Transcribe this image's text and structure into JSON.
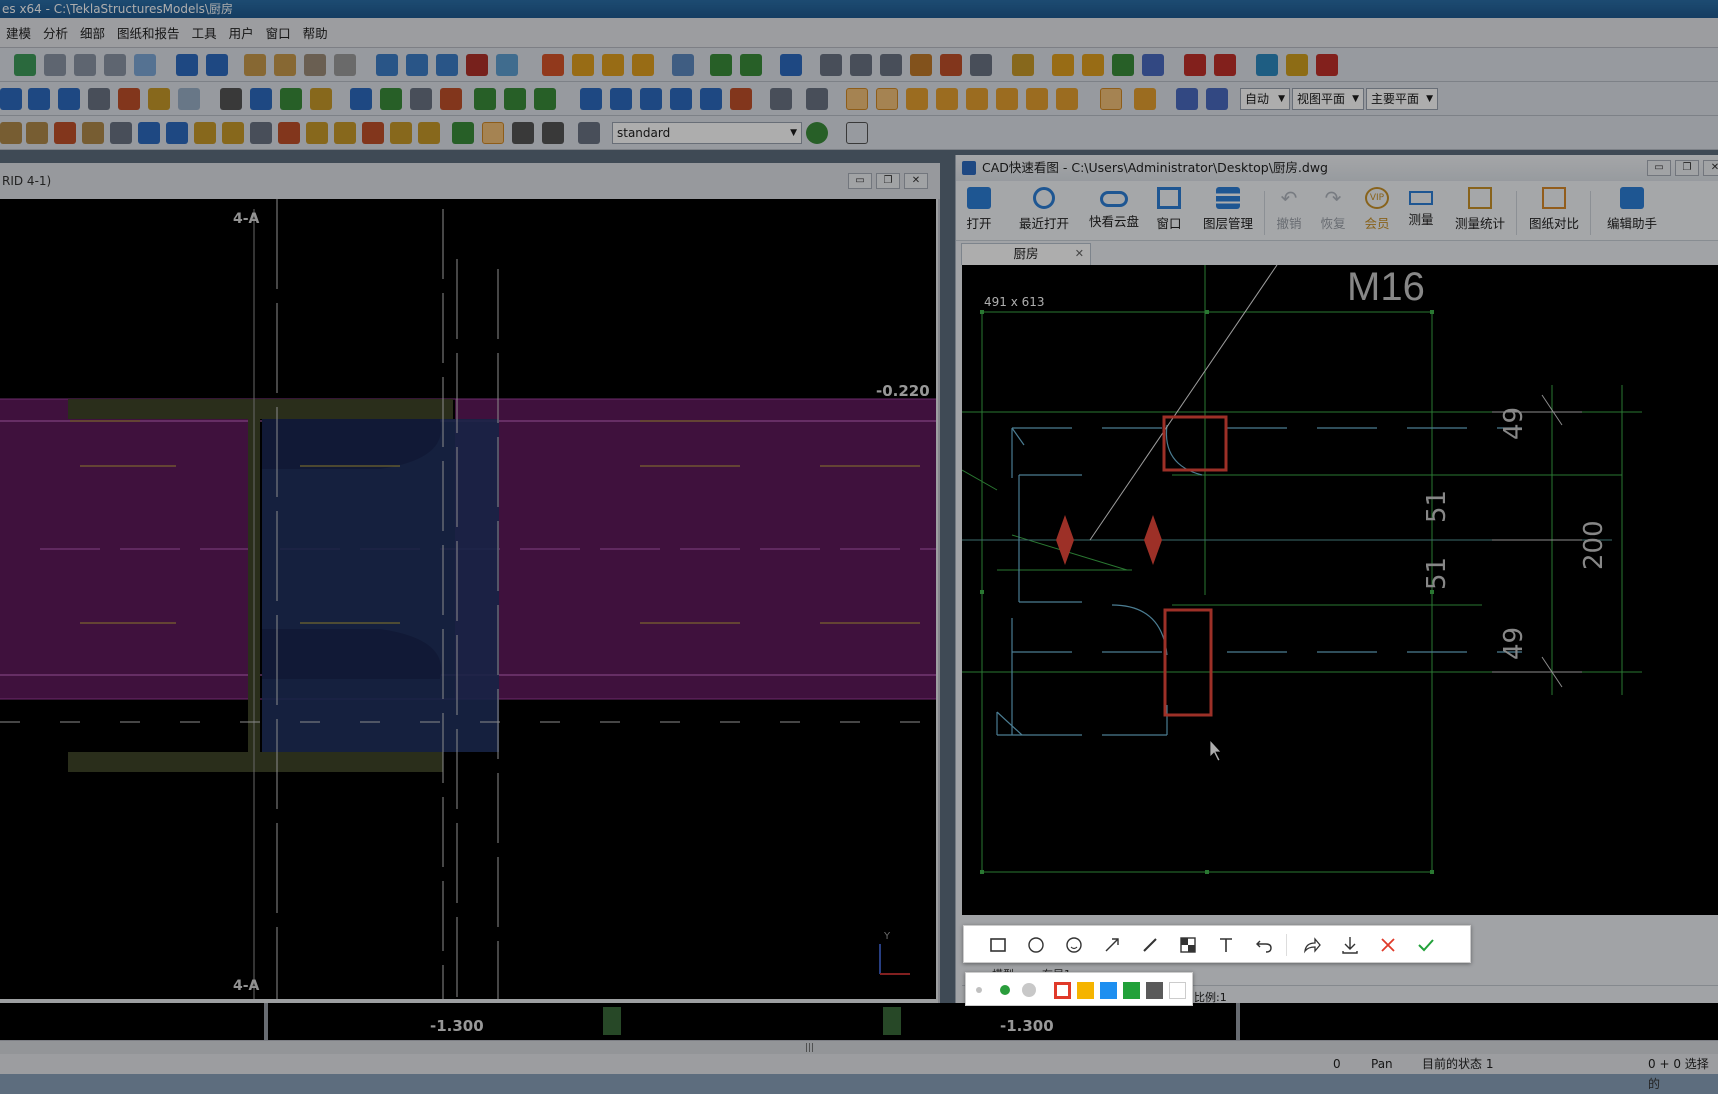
{
  "app": {
    "title": "es x64 - C:\\TeklaStructuresModels\\厨房"
  },
  "menubar": {
    "items": [
      "建模",
      "分析",
      "细部",
      "图纸和报告",
      "工具",
      "用户",
      "窗口",
      "帮助"
    ]
  },
  "toolbar": {
    "profile_select": "standard",
    "mode_select": "自动",
    "view_plane_select": "视图平面",
    "main_plane_select": "主要平面"
  },
  "left_view": {
    "title": "RID 4-1)",
    "grid_label_top": "4-A",
    "grid_label_bottom": "4-A",
    "elevation_label": "-0.220",
    "bottom_elev_left": "-1.300",
    "bottom_elev_right": "-1.300",
    "axis_y": "Y"
  },
  "cad_window": {
    "title": "CAD快速看图 - C:\\Users\\Administrator\\Desktop\\厨房.dwg",
    "ribbon": [
      {
        "label": "打开",
        "icon": "folder-open-icon"
      },
      {
        "label": "最近打开",
        "icon": "history-icon"
      },
      {
        "label": "快看云盘",
        "icon": "cloud-icon"
      },
      {
        "label": "窗口",
        "icon": "window-icon"
      },
      {
        "label": "图层管理",
        "icon": "layers-icon"
      },
      {
        "label": "撤销",
        "icon": "undo-icon"
      },
      {
        "label": "恢复",
        "icon": "redo-icon"
      },
      {
        "label": "会员",
        "icon": "vip-icon"
      },
      {
        "label": "测量",
        "icon": "ruler-icon"
      },
      {
        "label": "测量统计",
        "icon": "measure-stats-icon"
      },
      {
        "label": "图纸对比",
        "icon": "compare-icon"
      },
      {
        "label": "编辑助手",
        "icon": "edit-assistant-icon"
      }
    ],
    "tab_label": "厨房",
    "size_readout": "491 x 613",
    "drawing_text": {
      "top_label": "M16",
      "dim_49_top": "49",
      "dim_51_top": "51",
      "dim_51_bottom": "51",
      "dim_49_bottom": "49",
      "dim_200": "200"
    },
    "bottom_tabs": [
      "模型",
      "布局1"
    ],
    "scale_label": "比例:1"
  },
  "screenshot_tools": [
    "rectangle-icon",
    "ellipse-icon",
    "emoji-icon",
    "arrow-icon",
    "pen-icon",
    "mosaic-icon",
    "text-icon",
    "undo-icon",
    "share-icon",
    "download-icon",
    "cancel-icon",
    "confirm-icon"
  ],
  "color_swatches": [
    "#c0c0c0",
    "#2a9d3c",
    "#c8c8c8",
    "#e03a2a",
    "#f5b400",
    "#1e8ff0",
    "#22a13a",
    "#5a5a5a",
    "#ffffff"
  ],
  "statusbar": {
    "field_0": "0",
    "pan": "Pan",
    "state": "目前的状态 1",
    "selection": "0 + 0 选择的"
  },
  "colors": {
    "cad_green": "#3fb24a",
    "highlight_red": "#e8483a",
    "beam_magenta": "#6e1b6a",
    "plate_blue": "#2d3f78"
  }
}
